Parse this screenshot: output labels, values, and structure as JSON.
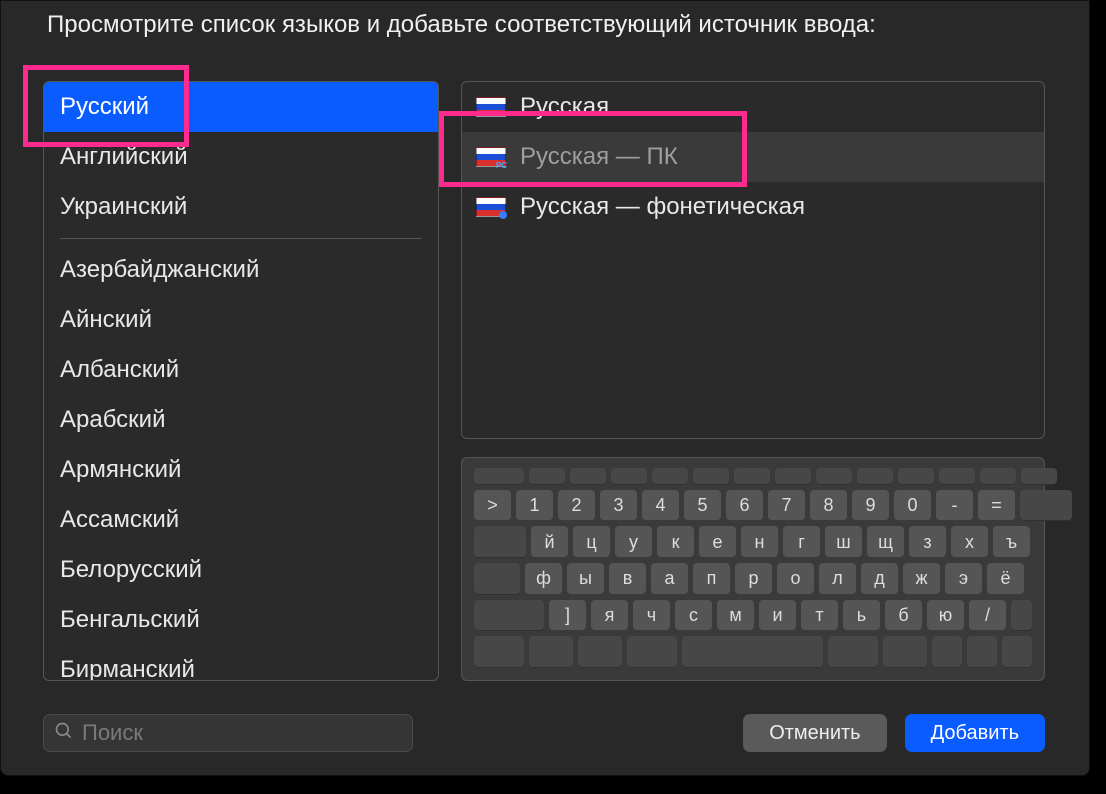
{
  "instruction": "Просмотрите список языков и добавьте соответствующий источник ввода:",
  "languages": {
    "top": [
      "Русский",
      "Английский",
      "Украинский"
    ],
    "rest": [
      "Азербайджанский",
      "Айнский",
      "Албанский",
      "Арабский",
      "Армянский",
      "Ассамский",
      "Белорусский",
      "Бенгальский",
      "Бирманский"
    ],
    "selected_index": 0
  },
  "input_sources": {
    "items": [
      {
        "label": "Русская",
        "flag": "ru"
      },
      {
        "label": "Русская — ПК",
        "flag": "pc"
      },
      {
        "label": "Русская — фонетическая",
        "flag": "phon"
      }
    ],
    "selected_index": 1
  },
  "keyboard_rows": [
    [
      ">",
      "1",
      "2",
      "3",
      "4",
      "5",
      "6",
      "7",
      "8",
      "9",
      "0",
      "-",
      "="
    ],
    [
      "й",
      "ц",
      "у",
      "к",
      "е",
      "н",
      "г",
      "ш",
      "щ",
      "з",
      "х",
      "ъ"
    ],
    [
      "ф",
      "ы",
      "в",
      "а",
      "п",
      "р",
      "о",
      "л",
      "д",
      "ж",
      "э",
      "ё"
    ],
    [
      "]",
      "я",
      "ч",
      "с",
      "м",
      "и",
      "т",
      "ь",
      "б",
      "ю",
      "/"
    ]
  ],
  "search_placeholder": "Поиск",
  "buttons": {
    "cancel": "Отменить",
    "add": "Добавить"
  },
  "highlight_colors": {
    "callout": "#ff2a8d"
  }
}
